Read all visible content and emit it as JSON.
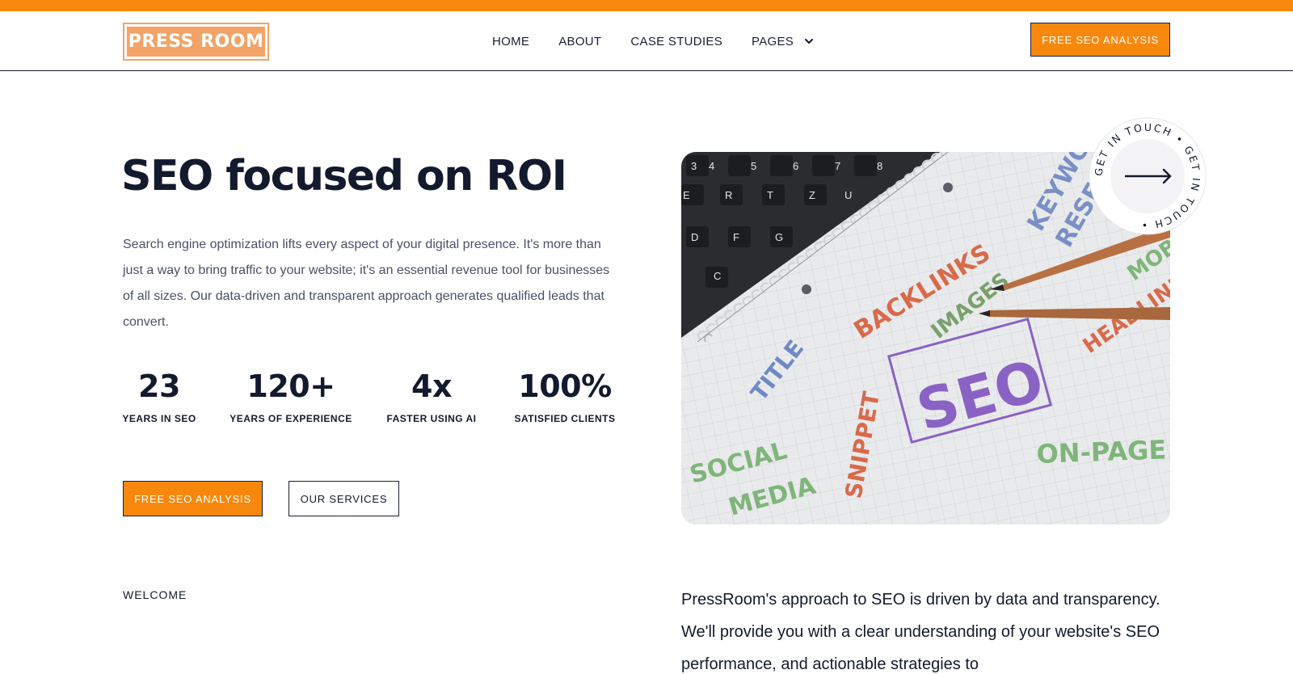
{
  "brand": {
    "logo_text": "PRESS ROOM",
    "accent": "#f7880d",
    "dark": "#131a2e"
  },
  "nav": {
    "items": [
      {
        "label": "HOME"
      },
      {
        "label": "ABOUT"
      },
      {
        "label": "CASE STUDIES"
      },
      {
        "label": "PAGES",
        "icon": "chevron-down-icon"
      }
    ],
    "cta_label": "FREE SEO ANALYSIS"
  },
  "hero": {
    "title_prefix": "SEO focused on ",
    "title_highlight": "ROI",
    "description": "Search engine optimization lifts every aspect of your digital presence. It's more than just a way to bring traffic to your website; it's an essential revenue tool for businesses of all sizes. Our data-driven and transparent approach generates qualified leads that convert.",
    "stats": [
      {
        "value": "23",
        "label": "YEARS IN SEO"
      },
      {
        "value": "120+",
        "label": "YEARS OF EXPERIENCE"
      },
      {
        "value": "4x",
        "label": "FASTER USING AI"
      },
      {
        "value": "100%",
        "label": "SATISFIED CLIENTS"
      }
    ],
    "primary_button": "FREE SEO ANALYSIS",
    "secondary_button": "OUR SERVICES",
    "image_words": [
      "KEYWORD",
      "RESEARCH",
      "BACKLINKS",
      "IMAGES",
      "TITLE",
      "SEO",
      "SOCIAL",
      "MEDIA",
      "SNIPPET",
      "ON-PAGE",
      "HEADLINE",
      "MOB"
    ],
    "keyboard_keys": [
      "3",
      "4",
      "5",
      "6",
      "7",
      "8",
      "E",
      "R",
      "T",
      "Z",
      "U",
      "D",
      "F",
      "G",
      "C"
    ],
    "badge_text": "GET IN TOUCH • GET IN TOUCH • ",
    "badge_icon": "arrow-right-icon"
  },
  "welcome": {
    "label": "WELCOME",
    "text": "PressRoom's approach to SEO is driven by data and transparency. We'll provide you with a clear understanding of your website's SEO performance, and actionable strategies to"
  }
}
